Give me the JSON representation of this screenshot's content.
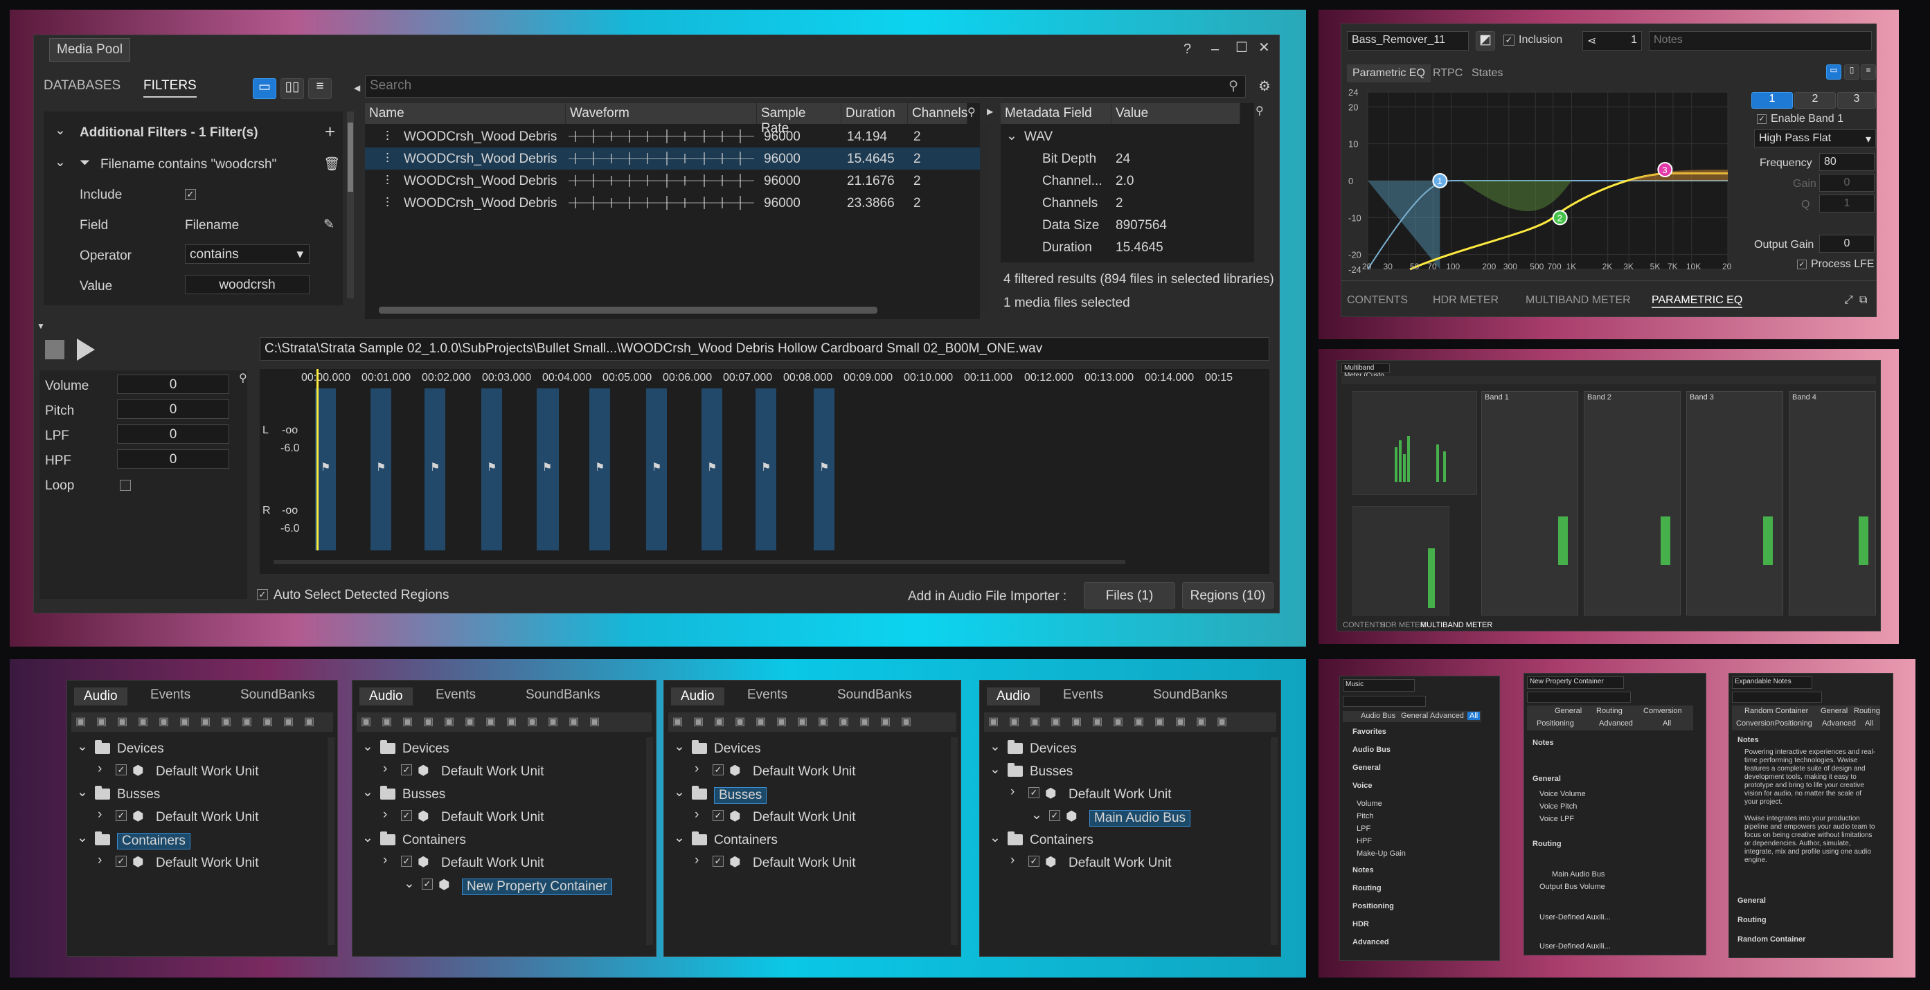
{
  "media_pool": {
    "title": "Media Pool",
    "tabs": [
      "DATABASES",
      "FILTERS"
    ],
    "search_placeholder": "Search",
    "filters_header": "Additional Filters - 1 Filter(s)",
    "filter_name": "Filename contains \"woodcrsh\"",
    "include_label": "Include",
    "field_label": "Field",
    "field_value": "Filename",
    "operator_label": "Operator",
    "operator_value": "contains",
    "value_label": "Value",
    "value_value": "woodcrsh",
    "columns": [
      "Name",
      "Waveform",
      "Sample Rate",
      "Duration",
      "Channels"
    ],
    "files": [
      {
        "name": "WOODCrsh_Wood Debris",
        "rate": "96000",
        "dur": "14.194",
        "ch": "2"
      },
      {
        "name": "WOODCrsh_Wood Debris",
        "rate": "96000",
        "dur": "15.4645",
        "ch": "2"
      },
      {
        "name": "WOODCrsh_Wood Debris",
        "rate": "96000",
        "dur": "21.1676",
        "ch": "2"
      },
      {
        "name": "WOODCrsh_Wood Debris",
        "rate": "96000",
        "dur": "23.3866",
        "ch": "2"
      }
    ],
    "meta_columns": [
      "Metadata Field",
      "Value"
    ],
    "meta_group": "WAV",
    "meta": [
      {
        "k": "Bit Depth",
        "v": "24"
      },
      {
        "k": "Channel...",
        "v": "2.0"
      },
      {
        "k": "Channels",
        "v": "2"
      },
      {
        "k": "Data Size",
        "v": "8907564"
      },
      {
        "k": "Duration",
        "v": "15.4645"
      }
    ],
    "results": "4 filtered results (894 files in selected libraries)",
    "selected": "1 media files selected",
    "path": "C:\\Strata\\Strata Sample 02_1.0.0\\SubProjects\\Bullet Small...\\WOODCrsh_Wood Debris Hollow Cardboard Small 02_B00M_ONE.wav",
    "props": [
      {
        "k": "Volume",
        "v": "0"
      },
      {
        "k": "Pitch",
        "v": "0"
      },
      {
        "k": "LPF",
        "v": "0"
      },
      {
        "k": "HPF",
        "v": "0"
      }
    ],
    "loop_label": "Loop",
    "timeline": [
      "00:00.000",
      "00:01.000",
      "00:02.000",
      "00:03.000",
      "00:04.000",
      "00:05.000",
      "00:06.000",
      "00:07.000",
      "00:08.000",
      "00:09.000",
      "00:10.000",
      "00:11.000",
      "00:12.000",
      "00:13.000",
      "00:14.000",
      "00:15"
    ],
    "ch_l": "L",
    "ch_r": "R",
    "db_inf": "-oo",
    "db_6": "-6.0",
    "auto_select": "Auto Select Detected Regions",
    "add_label": "Add in Audio File Importer :",
    "files_btn": "Files (1)",
    "regions_btn": "Regions (10)"
  },
  "eq": {
    "name": "Bass_Remover_11",
    "inclusion": "Inclusion",
    "count": "1",
    "notes_placeholder": "Notes",
    "tabs": [
      "Parametric EQ",
      "RTPC",
      "States"
    ],
    "bands": [
      "1",
      "2",
      "3"
    ],
    "enable_band": "Enable Band 1",
    "filter_type": "High Pass Flat",
    "frequency_label": "Frequency",
    "frequency_value": "80",
    "gain_label": "Gain",
    "gain_value": "0",
    "q_label": "Q",
    "q_value": "1",
    "output_gain_label": "Output Gain",
    "output_gain_value": "0",
    "process_lfe": "Process LFE",
    "y_ticks": [
      "24",
      "20",
      "10",
      "0",
      "-10",
      "-20",
      "-24"
    ],
    "x_ticks": [
      "20",
      "30",
      "50",
      "70",
      "100",
      "200",
      "300",
      "500",
      "700",
      "1K",
      "2K",
      "3K",
      "5K",
      "7K",
      "10K",
      "20K"
    ],
    "points": [
      "1",
      "2",
      "3"
    ],
    "bottom_tabs": [
      "CONTENTS",
      "HDR METER",
      "MULTIBAND METER",
      "PARAMETRIC EQ"
    ]
  },
  "mbm": {
    "title": "Multiband Meter (Custo",
    "bottom_tabs": [
      "CONTENTS",
      "HDR METER",
      "MULTIBAND METER"
    ],
    "bands": [
      "Band 1",
      "Band 2",
      "Band 3",
      "Band 4"
    ]
  },
  "trees": [
    {
      "tabs": [
        "Audio",
        "Events",
        "SoundBanks"
      ],
      "items": [
        "Devices",
        "Default Work Unit",
        "Busses",
        "Default Work Unit",
        "Containers",
        "Default Work Unit"
      ]
    },
    {
      "tabs": [
        "Audio",
        "Events",
        "SoundBanks"
      ],
      "items": [
        "Devices",
        "Default Work Unit",
        "Busses",
        "Default Work Unit",
        "Containers",
        "Default Work Unit",
        "New Property Container"
      ]
    },
    {
      "tabs": [
        "Audio",
        "Events",
        "SoundBanks"
      ],
      "items": [
        "Devices",
        "Default Work Unit",
        "Busses",
        "Default Work Unit",
        "Containers",
        "Default Work Unit"
      ]
    },
    {
      "tabs": [
        "Audio",
        "Events",
        "SoundBanks"
      ],
      "items": [
        "Devices",
        "Busses",
        "Default Work Unit",
        "Main Audio Bus",
        "Containers",
        "Default Work Unit"
      ]
    }
  ],
  "pe1": {
    "title": "Music",
    "sections": [
      "Favorites",
      "Audio Bus",
      "General",
      "Voice",
      "Notes",
      "Routing",
      "Positioning",
      "HDR",
      "Advanced"
    ],
    "voice": [
      "Volume",
      "Pitch",
      "LPF",
      "HPF",
      "Make-Up Gain"
    ],
    "tabs": [
      "Audio Bus",
      "General",
      "Advanced",
      "All"
    ]
  },
  "pe2": {
    "title": "New Property Container",
    "tabs": [
      "General",
      "Routing",
      "Conversion",
      "Positioning",
      "Advanced",
      "All"
    ],
    "sections": [
      "Notes",
      "General",
      "Routing"
    ],
    "general": [
      "Voice Volume",
      "Voice Pitch",
      "Voice LPF"
    ],
    "routing": [
      "Main Audio Bus",
      "Output Bus Volume",
      "User-Defined Auxili...",
      "User-Defined Auxili..."
    ]
  },
  "pe3": {
    "title": "Expandable Notes",
    "tabs": [
      "Random Container",
      "General",
      "Routing",
      "Conversion",
      "Positioning",
      "Advanced",
      "All"
    ],
    "sections": [
      "Notes",
      "General",
      "Routing",
      "Random Container"
    ],
    "notes": "Powering interactive experiences and real-time performing technologies. Wwise features a complete suite of design and development tools, making it easy to prototype and bring to life your creative vision for audio, no matter the scale of your project.\n\nWwise integrates into your production pipeline and empowers your audio team to focus on being creative without limitations or dependencies. Author, simulate, integrate, mix and profile using one audio engine."
  }
}
